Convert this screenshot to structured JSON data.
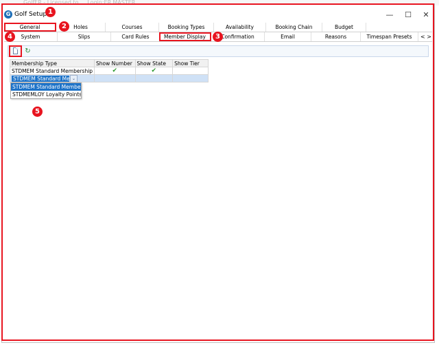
{
  "window": {
    "background_title": "GolfER - Licensed to ... Login:ER.MASTER",
    "title": "Golf Setup",
    "controls": {
      "minimize": "—",
      "maximize": "☐",
      "close": "✕"
    }
  },
  "badges": [
    "1",
    "2",
    "3",
    "4",
    "5"
  ],
  "tabs_row1": [
    "General",
    "Holes",
    "Courses",
    "Booking Types",
    "Availability",
    "Booking Chain",
    "Budget"
  ],
  "tabs_row2": [
    "System",
    "Slips",
    "Card Rules",
    "Member Display",
    "Confirmation",
    "Email",
    "Reasons",
    "Timespan Presets"
  ],
  "tab_scroll": "< >",
  "toolbar": {
    "new_icon": "new-document-icon",
    "refresh_icon": "refresh-icon",
    "refresh_glyph": "↻"
  },
  "grid": {
    "headers": [
      "Membership Type",
      "Show Number",
      "Show State",
      "Show Tier"
    ],
    "rows": [
      {
        "type": "STDMEM Standard Membership",
        "show_number": "✔",
        "show_state": "✔",
        "show_tier": ""
      }
    ],
    "editing_value": "STDMEM Standard Membersl",
    "dropdown_glyph": "⌄"
  },
  "dropdown": {
    "options": [
      "STDMEM Standard Membership",
      "STDMEMLOY Loyalty Points"
    ],
    "selected": "STDMEM Standard Membership"
  },
  "colors": {
    "accent_red": "#e8141f",
    "selection_blue": "#1e73c8",
    "check_green": "#2d9a2d"
  }
}
